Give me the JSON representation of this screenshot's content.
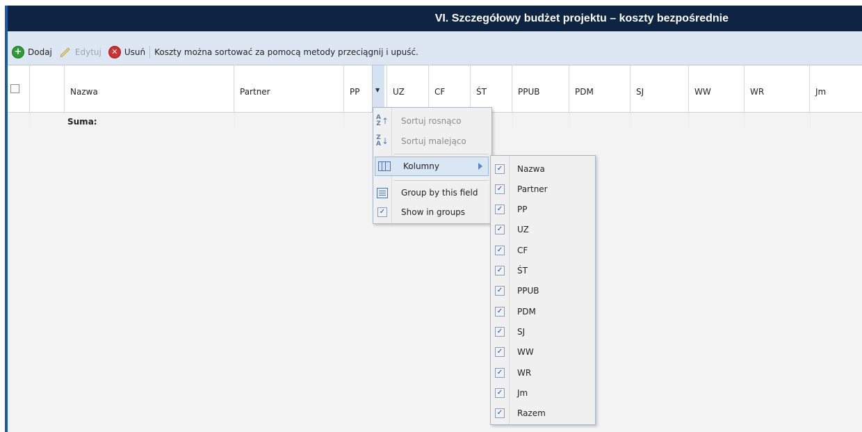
{
  "title": "VI. Szczegółowy budżet projektu – koszty bezpośrednie",
  "toolbar": {
    "add_label": "Dodaj",
    "edit_label": "Edytuj",
    "delete_label": "Usuń",
    "hint": "Koszty można sortować za pomocą metody przeciągnij i upuść."
  },
  "grid": {
    "columns": [
      "Nazwa",
      "Partner",
      "PP",
      "UZ",
      "CF",
      "ŚT",
      "PPUB",
      "PDM",
      "SJ",
      "WW",
      "WR",
      "Jm"
    ],
    "sum_label": "Suma:"
  },
  "column_menu": {
    "sort_asc": "Sortuj rosnąco",
    "sort_desc": "Sortuj malejąco",
    "columns": "Kolumny",
    "group_by": "Group by this field",
    "show_in_groups": "Show in groups"
  },
  "columns_submenu": [
    "Nazwa",
    "Partner",
    "PP",
    "UZ",
    "CF",
    "ŚT",
    "PPUB",
    "PDM",
    "SJ",
    "WW",
    "WR",
    "Jm",
    "Razem"
  ],
  "colors": {
    "title_bg": "#0e2443",
    "toolbar_bg": "#dde7f3",
    "accent": "#1b5aa6"
  }
}
